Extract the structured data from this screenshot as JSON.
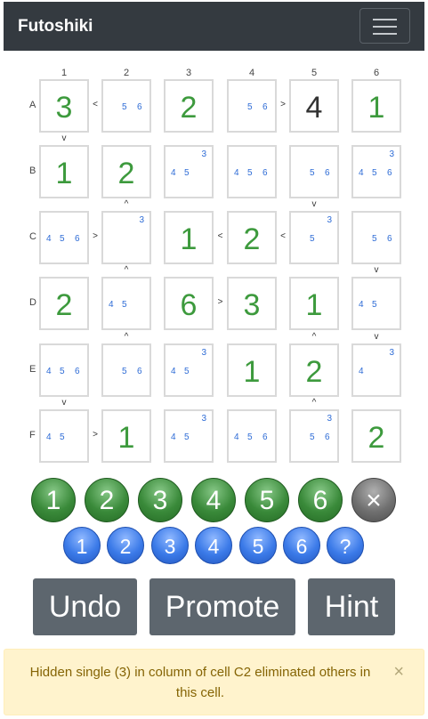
{
  "nav": {
    "brand": "Futoshiki"
  },
  "grid": {
    "col_labels": [
      "1",
      "2",
      "3",
      "4",
      "5",
      "6"
    ],
    "row_labels": [
      "A",
      "B",
      "C",
      "D",
      "E",
      "F"
    ],
    "cells": [
      [
        {
          "v": "3"
        },
        {
          "c": [
            "5",
            "6"
          ]
        },
        {
          "v": "2"
        },
        {
          "c": [
            "5",
            "6"
          ]
        },
        {
          "v": "4",
          "given": true
        },
        {
          "v": "1"
        }
      ],
      [
        {
          "v": "1"
        },
        {
          "v": "2"
        },
        {
          "c": [
            "3",
            "4",
            "5"
          ]
        },
        {
          "c": [
            "4",
            "5",
            "6"
          ]
        },
        {
          "c": [
            "5",
            "6"
          ]
        },
        {
          "c": [
            "3",
            "4",
            "5",
            "6"
          ]
        }
      ],
      [
        {
          "c": [
            "4",
            "5",
            "6"
          ]
        },
        {
          "c": [
            "3"
          ]
        },
        {
          "v": "1"
        },
        {
          "v": "2"
        },
        {
          "c": [
            "3",
            "5"
          ]
        },
        {
          "c": [
            "5",
            "6"
          ]
        }
      ],
      [
        {
          "v": "2"
        },
        {
          "c": [
            "4",
            "5"
          ]
        },
        {
          "v": "6"
        },
        {
          "v": "3"
        },
        {
          "v": "1"
        },
        {
          "c": [
            "4",
            "5"
          ]
        }
      ],
      [
        {
          "c": [
            "4",
            "5",
            "6"
          ]
        },
        {
          "c": [
            "5",
            "6"
          ]
        },
        {
          "c": [
            "3",
            "4",
            "5"
          ]
        },
        {
          "v": "1"
        },
        {
          "v": "2"
        },
        {
          "c": [
            "3",
            "4"
          ]
        }
      ],
      [
        {
          "c": [
            "4",
            "5"
          ]
        },
        {
          "v": "1"
        },
        {
          "c": [
            "3",
            "4",
            "5"
          ]
        },
        {
          "c": [
            "4",
            "5",
            "6"
          ]
        },
        {
          "c": [
            "3",
            "5",
            "6"
          ]
        },
        {
          "v": "2"
        }
      ]
    ],
    "h_ineq": [
      {
        "r": 0,
        "c": 0,
        "s": "<"
      },
      {
        "r": 0,
        "c": 3,
        "s": ">"
      },
      {
        "r": 2,
        "c": 0,
        "s": ">"
      },
      {
        "r": 2,
        "c": 2,
        "s": "<"
      },
      {
        "r": 2,
        "c": 3,
        "s": "<"
      },
      {
        "r": 3,
        "c": 2,
        "s": ">"
      },
      {
        "r": 5,
        "c": 0,
        "s": ">"
      }
    ],
    "v_ineq": [
      {
        "r": 0,
        "c": 0,
        "s": "v"
      },
      {
        "r": 1,
        "c": 1,
        "s": "^"
      },
      {
        "r": 1,
        "c": 4,
        "s": "v"
      },
      {
        "r": 2,
        "c": 1,
        "s": "^"
      },
      {
        "r": 2,
        "c": 5,
        "s": "v"
      },
      {
        "r": 3,
        "c": 1,
        "s": "^"
      },
      {
        "r": 3,
        "c": 4,
        "s": "^"
      },
      {
        "r": 3,
        "c": 5,
        "s": "v"
      },
      {
        "r": 4,
        "c": 0,
        "s": "v"
      },
      {
        "r": 4,
        "c": 4,
        "s": "^"
      }
    ]
  },
  "digit_buttons": [
    "1",
    "2",
    "3",
    "4",
    "5",
    "6"
  ],
  "clear_button": "×",
  "pencil_buttons": [
    "1",
    "2",
    "3",
    "4",
    "5",
    "6"
  ],
  "help_button": "?",
  "actions": {
    "undo": "Undo",
    "promote": "Promote",
    "hint": "Hint"
  },
  "alert": {
    "message": "Hidden single (3) in column of cell C2 eliminated others in this cell.",
    "close": "×"
  }
}
